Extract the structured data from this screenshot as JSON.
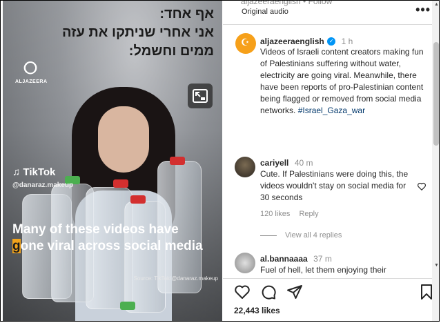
{
  "video": {
    "hebrew_line1": "אף אחד:",
    "hebrew_line2": "אני אחרי שניתקו את עזה",
    "hebrew_line3": "ממים וחשמל:",
    "logo_label": "ALJAZEERA",
    "tiktok_label": "TikTok",
    "tiktok_user": "@danaraz.makeup",
    "caption_part1": "Many of these videos have ",
    "caption_highlight": "g",
    "caption_part2": "one viral across social media",
    "source": "Source: TikTok/@danaraz.makeup"
  },
  "header": {
    "top_cut": "aljazeeraenglish  •  Follow",
    "audio": "Original audio",
    "more": "•••"
  },
  "post": {
    "username": "aljazeeraenglish",
    "time": "1 h",
    "text": "Videos of Israeli content creators making fun of Palestinians suffering without water, electricity are going viral. Meanwhile, there have been reports of pro-Palestinian content being flagged or removed from social media networks.",
    "hashtag": "#Israel_Gaza_war"
  },
  "comments": [
    {
      "username": "cariyell",
      "time": "40 m",
      "text": "Cute. If Palestinians were doing this, the videos wouldn't stay on social media for 30 seconds",
      "likes": "120 likes",
      "reply": "Reply",
      "view_replies": "View all 4 replies"
    },
    {
      "username": "al.bannaaaa",
      "time": "37 m",
      "text": "Fuel of hell, let them enjoying their"
    }
  ],
  "actions": {
    "likes_count": "22,443 likes"
  },
  "colors": {
    "link": "#00376b",
    "muted": "#8e8e8e",
    "verified": "#0095f6",
    "brand": "#f6a01a"
  }
}
